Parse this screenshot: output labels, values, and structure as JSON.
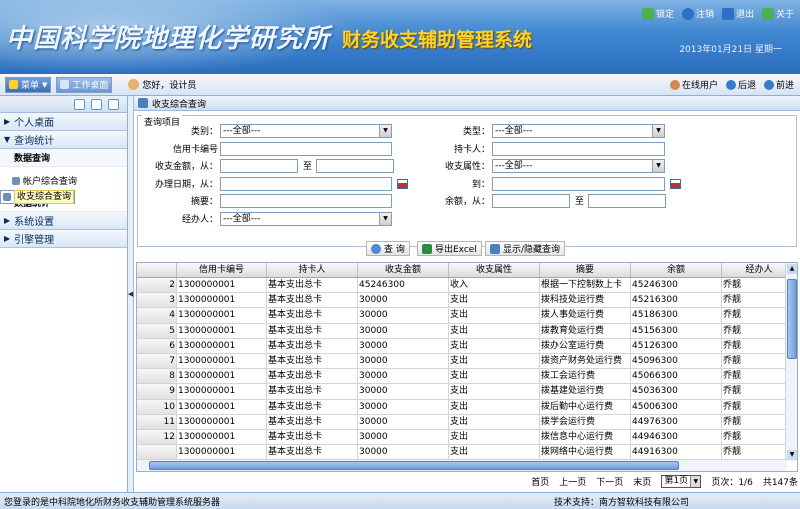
{
  "banner": {
    "org_name": "中国科学院地理化学研究所",
    "system_title": "财务收支辅助管理系统",
    "datetime": "2013年01月21日 星期一"
  },
  "top_links": [
    {
      "label": "锁定",
      "icon": "lock-icon",
      "color": "#4caf50"
    },
    {
      "label": "注销",
      "icon": "logout-icon",
      "color": "#2d6fc4"
    },
    {
      "label": "退出",
      "icon": "exit-icon",
      "color": "#2d6fc4"
    },
    {
      "label": "关于",
      "icon": "about-icon",
      "color": "#4caf50"
    }
  ],
  "toolbar": {
    "menu_label": "菜单",
    "desktop_label": "工作桌面",
    "greeting": "您好，设计员",
    "online_users": "在线用户",
    "back": "后退",
    "forward": "前进"
  },
  "sidebar": {
    "sections": [
      {
        "label": "个人桌面"
      },
      {
        "label": "查询统计"
      },
      {
        "label": "系统设置"
      },
      {
        "label": "引擎管理"
      }
    ],
    "sub_query": "数据查询",
    "items": [
      {
        "label": "帐户综合查询"
      },
      {
        "label": "收支综合查询"
      }
    ],
    "sub_stats": "数据统计"
  },
  "main": {
    "tab_title": "收支综合查询",
    "fieldset_legend": "查询项目"
  },
  "form": {
    "category_label": "类别：",
    "category_value": "---全部---",
    "type_label": "类型：",
    "type_value": "---全部---",
    "card_no_label": "信用卡编号",
    "holder_label": "持卡人：",
    "amount_label": "收支金额，从：",
    "to_label": "至",
    "attr_label": "收支属性：",
    "attr_value": "---全部---",
    "date_label": "办理日期，从：",
    "date_to_label": "到：",
    "summary_label": "摘要：",
    "balance_label": "余额，从：",
    "balance_to_label": "至",
    "handler_label": "经办人：",
    "handler_value": "---全部---"
  },
  "actions": {
    "query": "查 询",
    "export": "导出Excel",
    "toggle": "显示/隐藏查询"
  },
  "table": {
    "columns": [
      "",
      "信用卡编号",
      "持卡人",
      "收支金额",
      "收支属性",
      "摘要",
      "余额",
      "经办人"
    ],
    "rows": [
      [
        "2",
        "1300000001",
        "基本支出总卡",
        "45246300",
        "收入",
        "根据一下控制数上卡",
        "45246300",
        "乔靓"
      ],
      [
        "3",
        "1300000001",
        "基本支出总卡",
        "30000",
        "支出",
        "拨科技处运行费",
        "45216300",
        "乔靓"
      ],
      [
        "4",
        "1300000001",
        "基本支出总卡",
        "30000",
        "支出",
        "拨人事处运行费",
        "45186300",
        "乔靓"
      ],
      [
        "5",
        "1300000001",
        "基本支出总卡",
        "30000",
        "支出",
        "拨教育处运行费",
        "45156300",
        "乔靓"
      ],
      [
        "6",
        "1300000001",
        "基本支出总卡",
        "30000",
        "支出",
        "拨办公室运行费",
        "45126300",
        "乔靓"
      ],
      [
        "7",
        "1300000001",
        "基本支出总卡",
        "30000",
        "支出",
        "拨资产财务处运行费",
        "45096300",
        "乔靓"
      ],
      [
        "8",
        "1300000001",
        "基本支出总卡",
        "30000",
        "支出",
        "拨工会运行费",
        "45066300",
        "乔靓"
      ],
      [
        "9",
        "1300000001",
        "基本支出总卡",
        "30000",
        "支出",
        "拨基建处运行费",
        "45036300",
        "乔靓"
      ],
      [
        "10",
        "1300000001",
        "基本支出总卡",
        "30000",
        "支出",
        "拨后勤中心运行费",
        "45006300",
        "乔靓"
      ],
      [
        "11",
        "1300000001",
        "基本支出总卡",
        "30000",
        "支出",
        "拨学会运行费",
        "44976300",
        "乔靓"
      ],
      [
        "12",
        "1300000001",
        "基本支出总卡",
        "30000",
        "支出",
        "拨信息中心运行费",
        "44946300",
        "乔靓"
      ],
      [
        "",
        "1300000001",
        "基本支出总卡",
        "30000",
        "支出",
        "拨网络中心运行费",
        "44916300",
        "乔靓"
      ]
    ]
  },
  "pager": {
    "first": "首页",
    "prev": "上一页",
    "next": "下一页",
    "last": "末页",
    "page_select": "第1页",
    "page_info": "页次：1/6",
    "total": "共147条"
  },
  "status": {
    "left": "您登录的是中科院地化所财务收支辅助管理系统服务器",
    "right": "技术支持：南方智软科技有限公司"
  }
}
